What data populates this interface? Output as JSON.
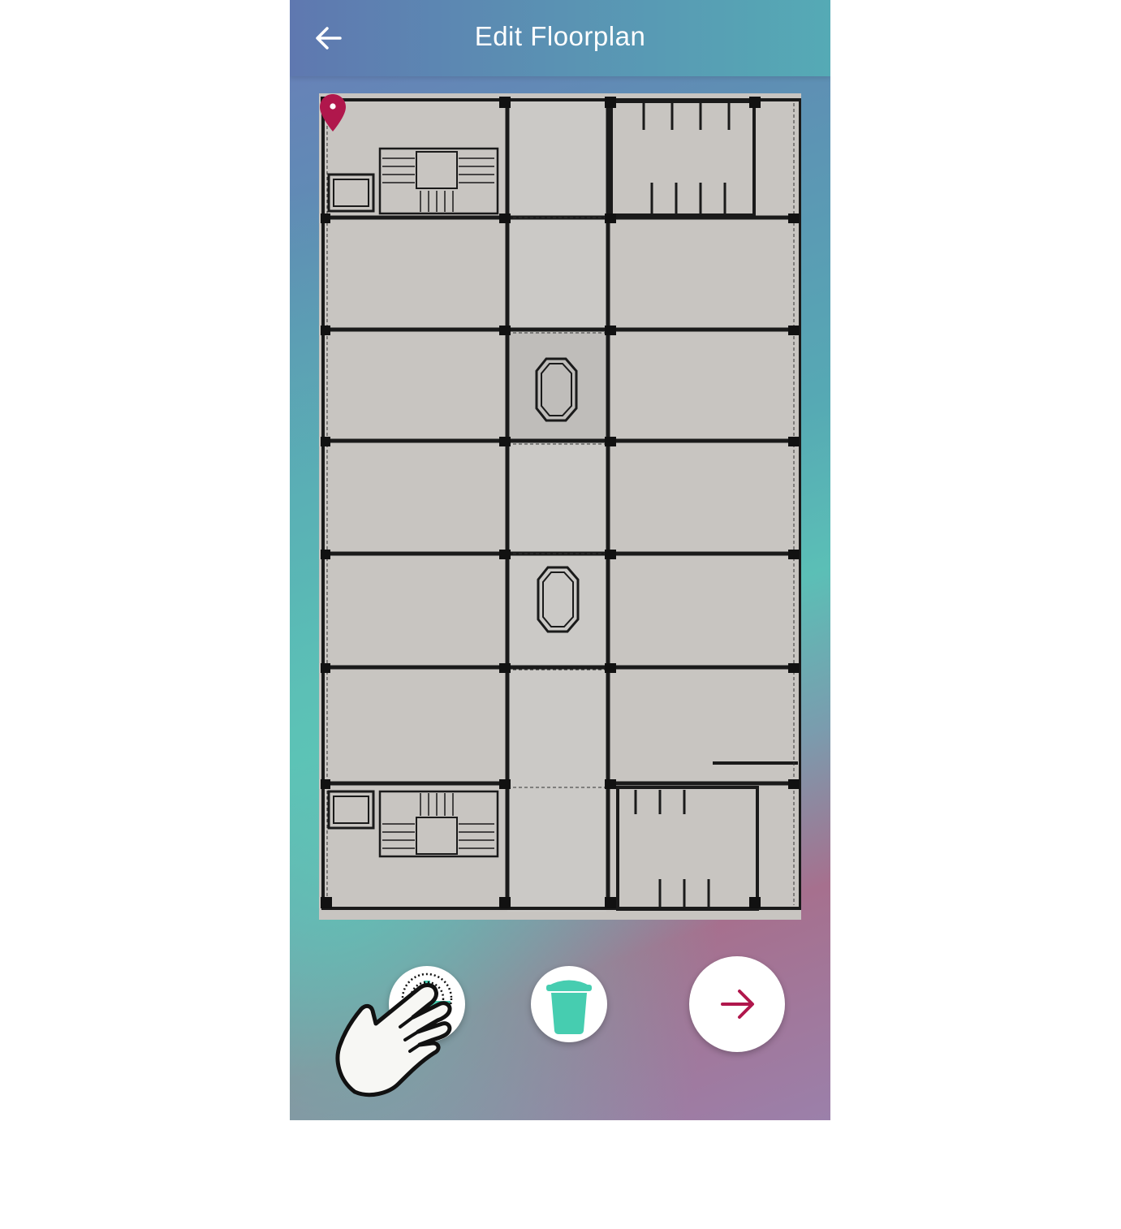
{
  "appbar": {
    "title": "Edit Floorplan",
    "back_icon": "arrow-left-icon"
  },
  "floorplan": {
    "image": "building-floorplan",
    "marker_icon": "map-pin-icon",
    "marker_color": "#b0174c"
  },
  "actions": {
    "add_icon": "plus-icon",
    "delete_icon": "trash-icon",
    "next_icon": "arrow-right-icon",
    "accent": "#46cdb0",
    "next_color": "#b0174c"
  },
  "gesture": {
    "icon": "tap-hand-icon"
  }
}
